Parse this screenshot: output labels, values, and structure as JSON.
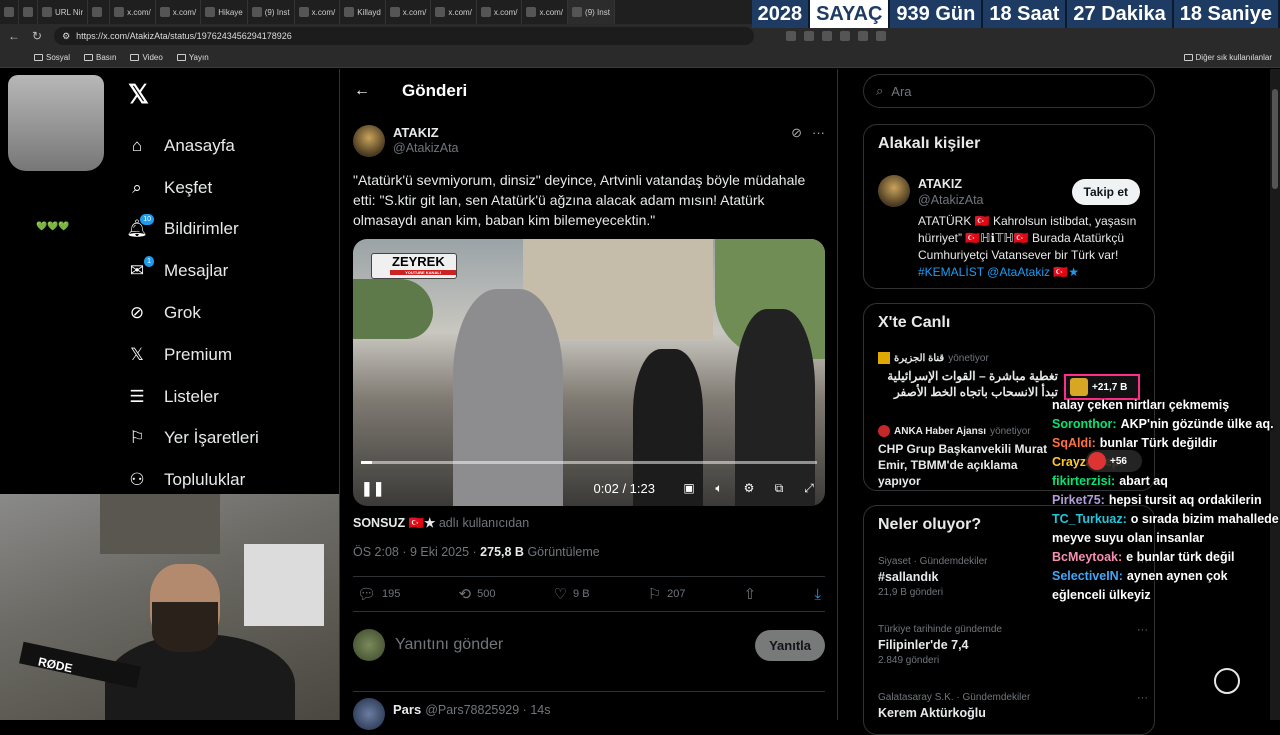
{
  "browser": {
    "tabs": [
      {
        "label": "URL Nir",
        "active": false
      },
      {
        "label": "",
        "active": false
      },
      {
        "label": "x.com/",
        "active": false
      },
      {
        "label": "x.com/",
        "active": false
      },
      {
        "label": "Hikaye",
        "active": false
      },
      {
        "label": "(9) Inst",
        "active": false
      },
      {
        "label": "x.com/",
        "active": false
      },
      {
        "label": "Killayd",
        "active": false
      },
      {
        "label": "x.com/",
        "active": false
      },
      {
        "label": "x.com/",
        "active": false
      },
      {
        "label": "x.com/",
        "active": false
      },
      {
        "label": "x.com/",
        "active": false
      },
      {
        "label": "(9) Inst",
        "active": true
      }
    ],
    "url": "https://x.com/AtakizAta/status/1976243456294178926",
    "bookmarks": [
      "Sosyal",
      "Basın",
      "Video",
      "Yayın"
    ],
    "other_bookmarks": "Diğer sık kullanılanlar"
  },
  "counter": {
    "year": "2028",
    "label": "SAYAÇ",
    "days": "939 Gün",
    "hours": "18 Saat",
    "minutes": "27 Dakika",
    "seconds": "18 Saniye"
  },
  "overlay": {
    "cup_text": "💚💚💚"
  },
  "nav": {
    "items": [
      {
        "icon": "home-icon",
        "label": "Anasayfa",
        "badge": ""
      },
      {
        "icon": "search-icon",
        "label": "Keşfet",
        "badge": ""
      },
      {
        "icon": "bell-icon",
        "label": "Bildirimler",
        "badge": "10"
      },
      {
        "icon": "mail-icon",
        "label": "Mesajlar",
        "badge": "1"
      },
      {
        "icon": "grok-icon",
        "label": "Grok",
        "badge": ""
      },
      {
        "icon": "x-icon",
        "label": "Premium",
        "badge": ""
      },
      {
        "icon": "list-icon",
        "label": "Listeler",
        "badge": ""
      },
      {
        "icon": "bookmark-icon",
        "label": "Yer İşaretleri",
        "badge": ""
      },
      {
        "icon": "communities-icon",
        "label": "Topluluklar",
        "badge": ""
      }
    ]
  },
  "webcam": {
    "mic_brand": "RØDE"
  },
  "header": {
    "title": "Gönderi"
  },
  "post": {
    "author_name": "ATAKIZ",
    "author_handle": "@AtakizAta",
    "text": "\"Atatürk'ü sevmiyorum, dinsiz\" deyince, Artvinli vatandaş böyle müdahale etti: \"S.ktir git lan, sen Atatürk'ü ağzına alacak adam mısın! Atatürk olmasaydı anan kim, baban kim bilemeyecektin.\"",
    "video": {
      "logo": "ZEYREK",
      "logo_sub": "YOUTUBE KANALI",
      "time": "0:02 / 1:23",
      "progress": 0.024
    },
    "from_user": "SONSUZ 🇹🇷★",
    "from_suffix": "adlı kullanıcıdan",
    "timestamp": "ÖS 2:08 · 9 Eki 2025 ·",
    "views": "275,8 B",
    "views_label": "Görüntüleme",
    "stats": {
      "replies": "195",
      "reposts": "500",
      "likes": "9 B",
      "bookmarks": "207"
    }
  },
  "reply_box": {
    "placeholder": "Yanıtını gönder",
    "button": "Yanıtla"
  },
  "next_reply": {
    "name": "Pars",
    "handle": "@Pars78825929 · 14s"
  },
  "sidebar_right": {
    "search_placeholder": "Ara",
    "related": {
      "title": "Alakalı kişiler",
      "name": "ATAKIZ",
      "handle": "@AtakizAta",
      "follow": "Takip et",
      "bio": "ATATÜRK 🇹🇷 Kahrolsun istibdat, yaşasın hürriyet” 🇹🇷ℍℹ𝕋ℍ🇹🇷 Burada Atatürkçü Cumhuriyetçi Vatansever bir Türk var!",
      "bio_tags": "#KEMALİST @AtaAtakiz 🇹🇷★"
    },
    "live": {
      "title": "X'te Canlı",
      "items": [
        {
          "source": "قناة الجزيرة",
          "status": "yönetiyor",
          "text": "تغطية مباشرة – القوات الإسرائيلية تبدأ الانسحاب باتجاه الخط الأصفر"
        },
        {
          "source": "ANKA Haber Ajansı",
          "status": "yönetiyor",
          "text": "CHP Grup Başkanvekili Murat Emir, TBMM'de açıklama yapıyor"
        }
      ]
    },
    "trends": {
      "title": "Neler oluyor?",
      "items": [
        {
          "context": "Siyaset · Gündemdekiler",
          "topic": "#sallandık",
          "count": "21,9 B gönderi"
        },
        {
          "context": "Türkiye tarihinde gündemde",
          "topic": "Filipinler'de 7,4",
          "count": "2.849 gönderi"
        },
        {
          "context": "Galatasaray S.K. · Gündemdekiler",
          "topic": "Kerem Aktürkoğlu",
          "count": ""
        }
      ]
    }
  },
  "stream": {
    "goal": "+21,7 B",
    "gift": "+56",
    "chat": [
      {
        "user": "",
        "color": "#ffffff",
        "text": "nalay çeken nirtları çekmemiş"
      },
      {
        "user": "Soronthor:",
        "color": "#00e676",
        "text": "AKP'nin gözünde ülke aq."
      },
      {
        "user": "SqAldi:",
        "color": "#ff7043",
        "text": "bunlar Türk değildir"
      },
      {
        "user": "Crayzakrep:",
        "color": "#ffca28",
        "text": ""
      },
      {
        "user": "fikirterzisi:",
        "color": "#00e676",
        "text": "abart aq"
      },
      {
        "user": "Pirket75:",
        "color": "#b39ddb",
        "text": "hepsi tursit aq ordakilerin"
      },
      {
        "user": "TC_Turkuaz:",
        "color": "#26c6da",
        "text": "o sırada bizim mahallede meyve suyu olan insanlar"
      },
      {
        "user": "BcMeytoak:",
        "color": "#f48fb1",
        "text": "e bunlar türk değil"
      },
      {
        "user": "SelectiveIN:",
        "color": "#42a5f5",
        "text": "aynen aynen çok eğlenceli ülkeyiz"
      }
    ]
  }
}
